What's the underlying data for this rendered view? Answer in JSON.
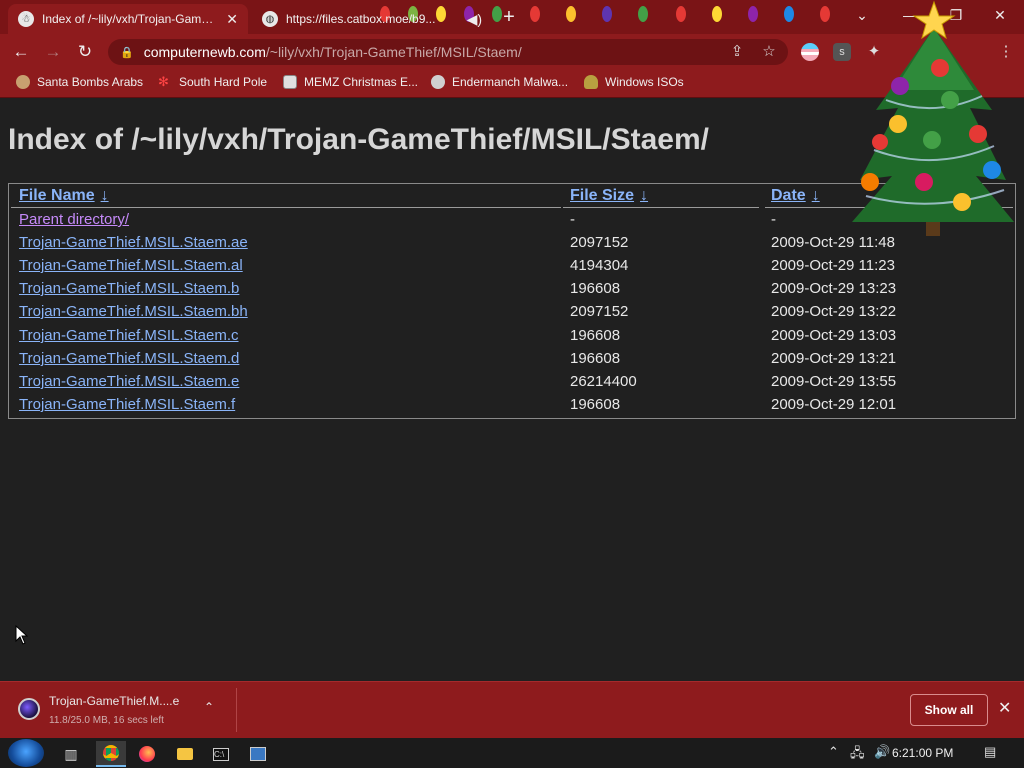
{
  "tabs": [
    {
      "title": "Index of /~lily/vxh/Trojan-GameThief/MSIL/Staem/",
      "active": true
    },
    {
      "title": "https://files.catbox.moe/b9...",
      "active": false
    }
  ],
  "window_controls": {
    "minimize": "—",
    "maximize": "❐",
    "close": "✕",
    "tab_search": "⌄"
  },
  "address_bar": {
    "domain": "computernewb.com",
    "path": "/~lily/vxh/Trojan-GameThief/MSIL/Staem/"
  },
  "bookmarks": [
    {
      "label": "Santa Bombs Arabs",
      "icon": "santa-icon"
    },
    {
      "label": "South Hard Pole",
      "icon": "snowflake-icon"
    },
    {
      "label": "MEMZ Christmas E...",
      "icon": "memz-icon"
    },
    {
      "label": "Endermanch Malwa...",
      "icon": "raccoon-icon"
    },
    {
      "label": "Windows ISOs",
      "icon": "gnome-icon"
    }
  ],
  "page": {
    "heading": "Index of /~lily/vxh/Trojan-GameThief/MSIL/Staem/",
    "columns": {
      "name": "File Name",
      "size": "File Size",
      "date": "Date",
      "sort_arrow": "↓"
    },
    "rows": [
      {
        "name": "Parent directory/",
        "size": "-",
        "date": "-",
        "visited": true
      },
      {
        "name": "Trojan-GameThief.MSIL.Staem.ae",
        "size": "2097152",
        "date": "2009-Oct-29 11:48",
        "visited": false
      },
      {
        "name": "Trojan-GameThief.MSIL.Staem.al",
        "size": "4194304",
        "date": "2009-Oct-29 11:23",
        "visited": false
      },
      {
        "name": "Trojan-GameThief.MSIL.Staem.b",
        "size": "196608",
        "date": "2009-Oct-29 13:23",
        "visited": false
      },
      {
        "name": "Trojan-GameThief.MSIL.Staem.bh",
        "size": "2097152",
        "date": "2009-Oct-29 13:22",
        "visited": false
      },
      {
        "name": "Trojan-GameThief.MSIL.Staem.c",
        "size": "196608",
        "date": "2009-Oct-29 13:03",
        "visited": false
      },
      {
        "name": "Trojan-GameThief.MSIL.Staem.d",
        "size": "196608",
        "date": "2009-Oct-29 13:21",
        "visited": false
      },
      {
        "name": "Trojan-GameThief.MSIL.Staem.e",
        "size": "26214400",
        "date": "2009-Oct-29 13:55",
        "visited": false
      },
      {
        "name": "Trojan-GameThief.MSIL.Staem.f",
        "size": "196608",
        "date": "2009-Oct-29 12:01",
        "visited": false
      }
    ]
  },
  "download": {
    "filename": "Trojan-GameThief.M....e",
    "status": "11.8/25.0 MB, 16 secs left",
    "progress_fraction": 0.472,
    "show_all": "Show all"
  },
  "taskbar": {
    "clock": "6:21:00 PM",
    "apps": [
      "task-view-icon",
      "chrome-icon",
      "firefox-icon",
      "file-explorer-icon",
      "cmd-icon",
      "network-app-icon"
    ]
  },
  "colors": {
    "chrome_red": "#8e1b1d",
    "link": "#8ab4f8",
    "visited_link": "#c58af9",
    "page_bg": "#202020"
  }
}
